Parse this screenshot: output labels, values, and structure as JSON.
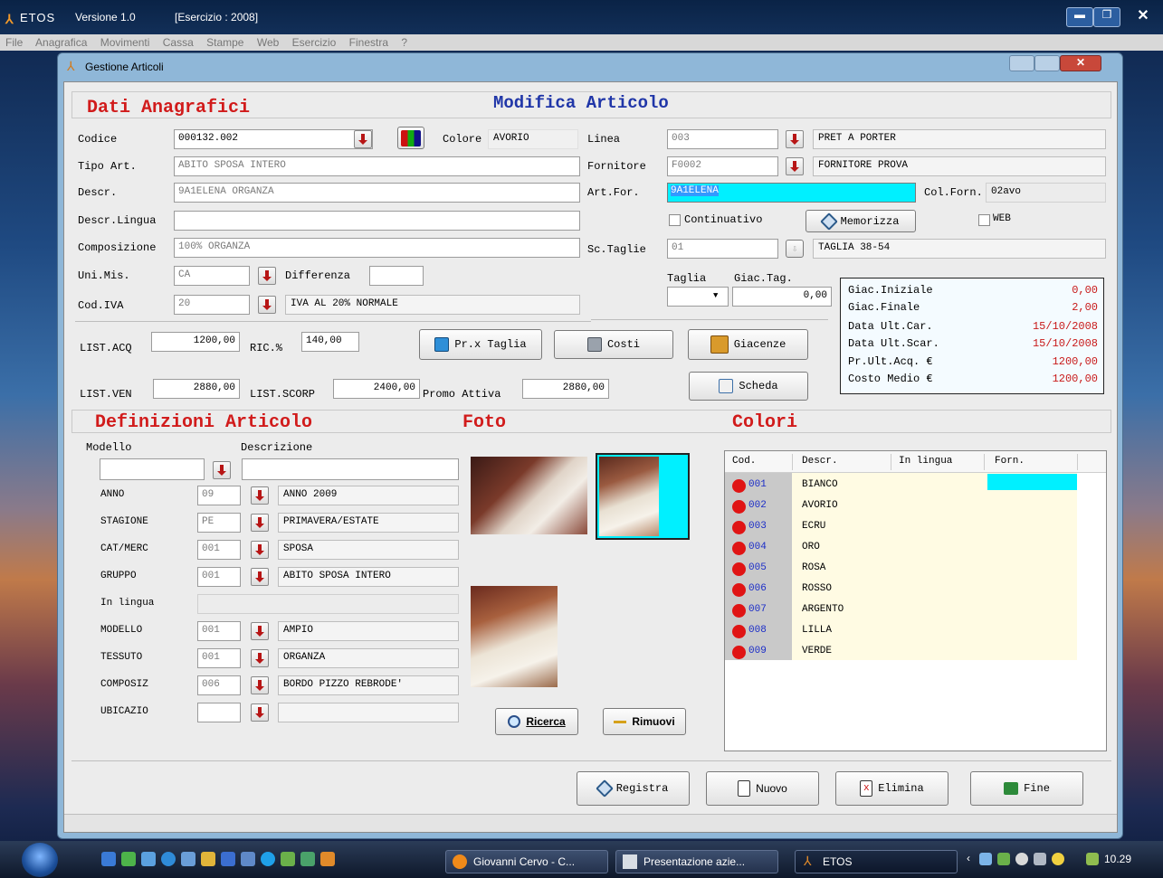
{
  "app": {
    "title_name": "ETOS",
    "version": "Versione 1.0",
    "exercise": "[Esercizio : 2008]"
  },
  "menu": [
    "File",
    "Anagrafica",
    "Movimenti",
    "Cassa",
    "Stampe",
    "Web",
    "Esercizio",
    "Finestra",
    "?"
  ],
  "window": {
    "title": "Gestione Articoli"
  },
  "header": {
    "left": "Dati Anagrafici",
    "center": "Modifica Articolo"
  },
  "anagrafica": {
    "codice": {
      "label": "Codice",
      "value": "000132.002"
    },
    "colore": {
      "label": "Colore",
      "value": "AVORIO"
    },
    "tipo_art": {
      "label": "Tipo Art.",
      "value": "ABITO SPOSA INTERO"
    },
    "descr": {
      "label": "Descr.",
      "value": "9A1ELENA ORGANZA"
    },
    "descr_lingua": {
      "label": "Descr.Lingua",
      "value": ""
    },
    "composizione": {
      "label": "Composizione",
      "value": "100% ORGANZA"
    },
    "uni_mis": {
      "label": "Uni.Mis.",
      "value": "CA"
    },
    "differenza": {
      "label": "Differenza",
      "value": ""
    },
    "cod_iva": {
      "label": "Cod.IVA",
      "value": "20",
      "desc": "IVA AL 20% NORMALE"
    },
    "linea": {
      "label": "Linea",
      "value": "003",
      "desc": "PRET A PORTER"
    },
    "fornitore": {
      "label": "Fornitore",
      "value": "F0002",
      "desc": "FORNITORE PROVA"
    },
    "art_for": {
      "label": "Art.For.",
      "value": "9A1ELENA"
    },
    "col_forn": {
      "label": "Col.Forn.",
      "value": "02avo"
    },
    "continuativo": "Continuativo",
    "memorizza": "Memorizza",
    "web": "WEB",
    "sc_taglie": {
      "label": "Sc.Taglie",
      "value": "01",
      "desc": "TAGLIA 38-54"
    },
    "taglia": {
      "label": "Taglia"
    },
    "giac_tag": {
      "label": "Giac.Tag.",
      "value": "0,00"
    }
  },
  "prezzi": {
    "list_acq": {
      "label": "LIST.ACQ",
      "value": "1200,00"
    },
    "ric": {
      "label": "RIC.%",
      "value": "140,00"
    },
    "list_ven": {
      "label": "LIST.VEN",
      "value": "2880,00"
    },
    "list_scorp": {
      "label": "LIST.SCORP",
      "value": "2400,00"
    },
    "promo": {
      "label": "Promo Attiva",
      "value": "2880,00"
    }
  },
  "buttons": {
    "pr_taglia": "Pr.x Taglia",
    "costi": "Costi",
    "giacenze": "Giacenze",
    "scheda": "Scheda",
    "ricerca": "Ricerca",
    "rimuovi": "Rimuovi",
    "registra": "Registra",
    "nuovo": "Nuovo",
    "elimina": "Elimina",
    "fine": "Fine"
  },
  "giacenze_box": [
    {
      "label": "Giac.Iniziale",
      "value": "0,00"
    },
    {
      "label": "Giac.Finale",
      "value": "2,00"
    },
    {
      "label": "Data Ult.Car.",
      "value": "15/10/2008"
    },
    {
      "label": "Data Ult.Scar.",
      "value": "15/10/2008"
    },
    {
      "label": "Pr.Ult.Acq. €",
      "value": "1200,00"
    },
    {
      "label": "Costo Medio €",
      "value": "1200,00"
    }
  ],
  "definizioni": {
    "title": "Definizioni Articolo",
    "modello_hdr": "Modello",
    "descrizione_hdr": "Descrizione",
    "rows": [
      {
        "label": "ANNO",
        "code": "09",
        "desc": "ANNO 2009"
      },
      {
        "label": "STAGIONE",
        "code": "PE",
        "desc": "PRIMAVERA/ESTATE"
      },
      {
        "label": "CAT/MERC",
        "code": "001",
        "desc": "SPOSA"
      },
      {
        "label": "GRUPPO",
        "code": "001",
        "desc": "ABITO SPOSA INTERO"
      },
      {
        "label": "In lingua",
        "code": "",
        "desc": ""
      },
      {
        "label": "MODELLO",
        "code": "001",
        "desc": "AMPIO"
      },
      {
        "label": "TESSUTO",
        "code": "001",
        "desc": "ORGANZA"
      },
      {
        "label": "COMPOSIZ",
        "code": "006",
        "desc": "BORDO PIZZO REBRODE'"
      },
      {
        "label": "UBICAZIO",
        "code": "",
        "desc": ""
      }
    ]
  },
  "foto": {
    "title": "Foto"
  },
  "colori": {
    "title": "Colori",
    "columns": [
      "Cod.",
      "Descr.",
      "In lingua",
      "Forn."
    ],
    "rows": [
      {
        "cod": "001",
        "descr": "BIANCO"
      },
      {
        "cod": "002",
        "descr": "AVORIO"
      },
      {
        "cod": "003",
        "descr": "ECRU"
      },
      {
        "cod": "004",
        "descr": "ORO"
      },
      {
        "cod": "005",
        "descr": "ROSA"
      },
      {
        "cod": "006",
        "descr": "ROSSO"
      },
      {
        "cod": "007",
        "descr": "ARGENTO"
      },
      {
        "cod": "008",
        "descr": "LILLA"
      },
      {
        "cod": "009",
        "descr": "VERDE"
      }
    ]
  },
  "taskbar": {
    "items": [
      "Giovanni Cervo - C...",
      "Presentazione azie...",
      "ETOS"
    ],
    "clock": "10.29"
  },
  "colors": {
    "title_red": "#d11b1b",
    "title_blue": "#2036a8",
    "highlight": "#00f0ff",
    "dot": "#e01414",
    "stock_red": "#c81a1a"
  }
}
